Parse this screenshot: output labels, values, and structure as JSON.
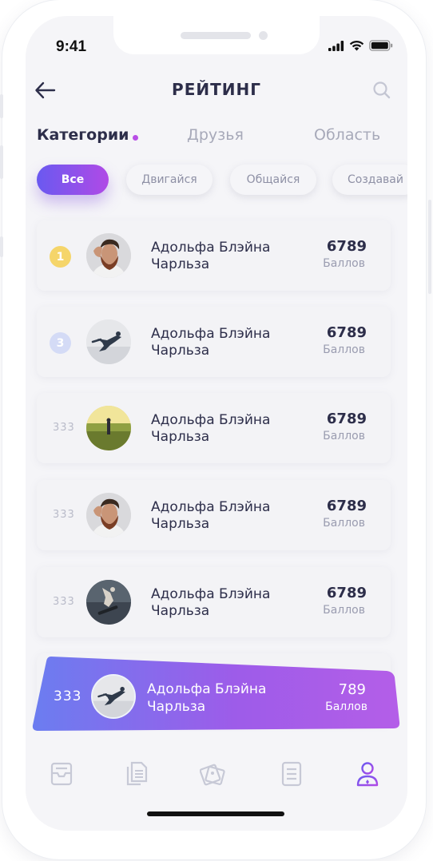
{
  "status": {
    "time": "9:41"
  },
  "header": {
    "title": "РЕЙТИНГ"
  },
  "tabs": [
    {
      "label": "Категории",
      "active": true
    },
    {
      "label": "Друзья",
      "active": false
    },
    {
      "label": "Область",
      "active": false
    }
  ],
  "chips": [
    {
      "label": "Все",
      "active": true
    },
    {
      "label": "Двигайся",
      "active": false
    },
    {
      "label": "Общайся",
      "active": false
    },
    {
      "label": "Создавай",
      "active": false
    }
  ],
  "colors": {
    "accent_start": "#6a59f0",
    "accent_end": "#b04ae6",
    "gold_badge": "#f5d56a",
    "silver_badge": "#d4dbf6",
    "text_dark": "#2d2e4a",
    "text_muted": "#9a9cb0"
  },
  "rating_list": [
    {
      "rank": "1",
      "name_line1": "Адольфа Блэйна",
      "name_line2": "Чарльза",
      "score": "6789",
      "score_label": "Баллов",
      "avatar": "bearded-man-photo"
    },
    {
      "rank": "3",
      "name_line1": "Адольфа Блэйна",
      "name_line2": "Чарльза",
      "score": "6789",
      "score_label": "Баллов",
      "avatar": "jumping-person-photo"
    },
    {
      "rank": "333",
      "name_line1": "Адольфа Блэйна",
      "name_line2": "Чарльза",
      "score": "6789",
      "score_label": "Баллов",
      "avatar": "field-sunset-photo"
    },
    {
      "rank": "333",
      "name_line1": "Адольфа Блэйна",
      "name_line2": "Чарльза",
      "score": "6789",
      "score_label": "Баллов",
      "avatar": "bearded-man-photo"
    },
    {
      "rank": "333",
      "name_line1": "Адольфа Блэйна",
      "name_line2": "Чарльза",
      "score": "6789",
      "score_label": "Баллов",
      "avatar": "skater-jump-photo"
    }
  ],
  "current_user": {
    "rank": "333",
    "name_line1": "Адольфа Блэйна",
    "name_line2": "Чарльза",
    "score": "789",
    "score_label": "Баллов",
    "avatar": "jumping-person-photo"
  },
  "bottom_nav": [
    {
      "icon": "inbox-icon",
      "active": false
    },
    {
      "icon": "documents-icon",
      "active": false
    },
    {
      "icon": "photos-icon",
      "active": false
    },
    {
      "icon": "list-icon",
      "active": false
    },
    {
      "icon": "profile-icon",
      "active": true
    }
  ]
}
